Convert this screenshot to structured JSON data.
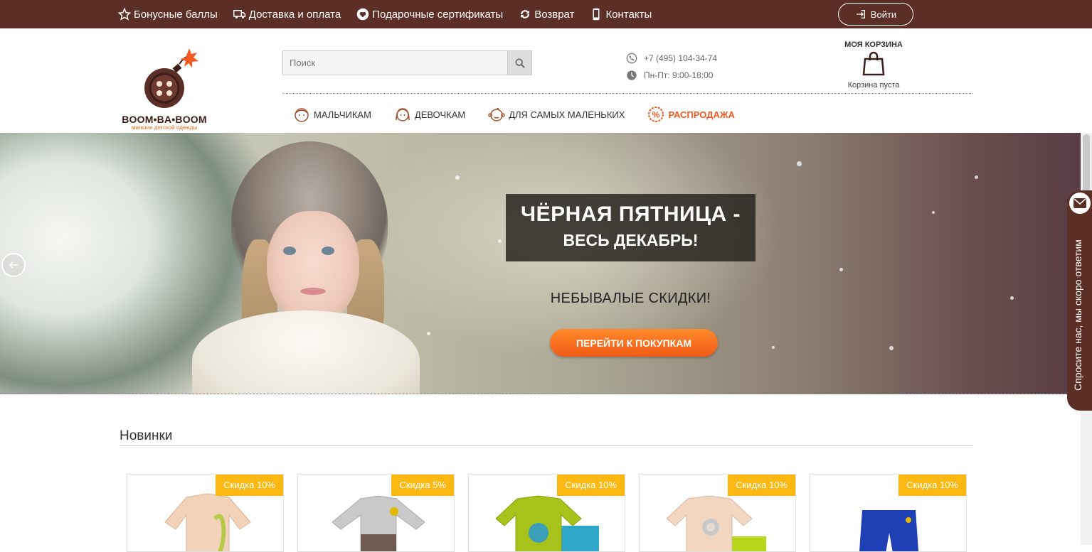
{
  "topnav": {
    "items": [
      {
        "label": "Бонусные баллы",
        "icon": "star-icon"
      },
      {
        "label": "Доставка и оплата",
        "icon": "truck-icon"
      },
      {
        "label": "Подарочные сертификаты",
        "icon": "heart-icon"
      },
      {
        "label": "Возврат",
        "icon": "refresh-icon"
      },
      {
        "label": "Контакты",
        "icon": "phone-icon"
      }
    ],
    "login_label": "Войти"
  },
  "logo": {
    "name": "BOOM•BA•BOOM",
    "tagline": "магазин детской одежды"
  },
  "search": {
    "placeholder": "Поиск"
  },
  "contacts": {
    "phone": "+7 (495) 104-34-74",
    "hours": "Пн-Пт: 9:00-18:00"
  },
  "cart": {
    "title": "МОЯ КОРЗИНА",
    "status": "Корзина пуста"
  },
  "categories": [
    {
      "label": "МАЛЬЧИКАМ",
      "icon": "boy-icon"
    },
    {
      "label": "ДЕВОЧКАМ",
      "icon": "girl-icon"
    },
    {
      "label": "ДЛЯ САМЫХ МАЛЕНЬКИХ",
      "icon": "baby-icon"
    },
    {
      "label": "РАСПРОДАЖА",
      "icon": "percent-icon"
    }
  ],
  "hero": {
    "title_line1": "ЧЁРНАЯ ПЯТНИЦА -",
    "title_line2": "ВЕСЬ ДЕКАБРЬ!",
    "subtitle": "НЕБЫВАЛЫЕ СКИДКИ!",
    "cta": "ПЕРЕЙТИ К ПОКУПКАМ"
  },
  "chat": {
    "label": "Спросите нас, мы скоро ответим"
  },
  "new_items": {
    "title": "Новинки",
    "products": [
      {
        "badge": "Скидка 10%",
        "color_main": "#f2d2b8",
        "color_accent": "#b8c94a"
      },
      {
        "badge": "Скидка 5%",
        "color_main": "#c9c9c9",
        "color_accent": "#6e5a4e"
      },
      {
        "badge": "Скидка 10%",
        "color_main": "#a8c21c",
        "color_accent": "#2fa7c9"
      },
      {
        "badge": "Скидка 10%",
        "color_main": "#f2d6c0",
        "color_accent": "#b8d61c"
      },
      {
        "badge": "Скидка 10%",
        "color_main": "#1f3fb5",
        "color_accent": "#1f3fb5"
      }
    ]
  }
}
